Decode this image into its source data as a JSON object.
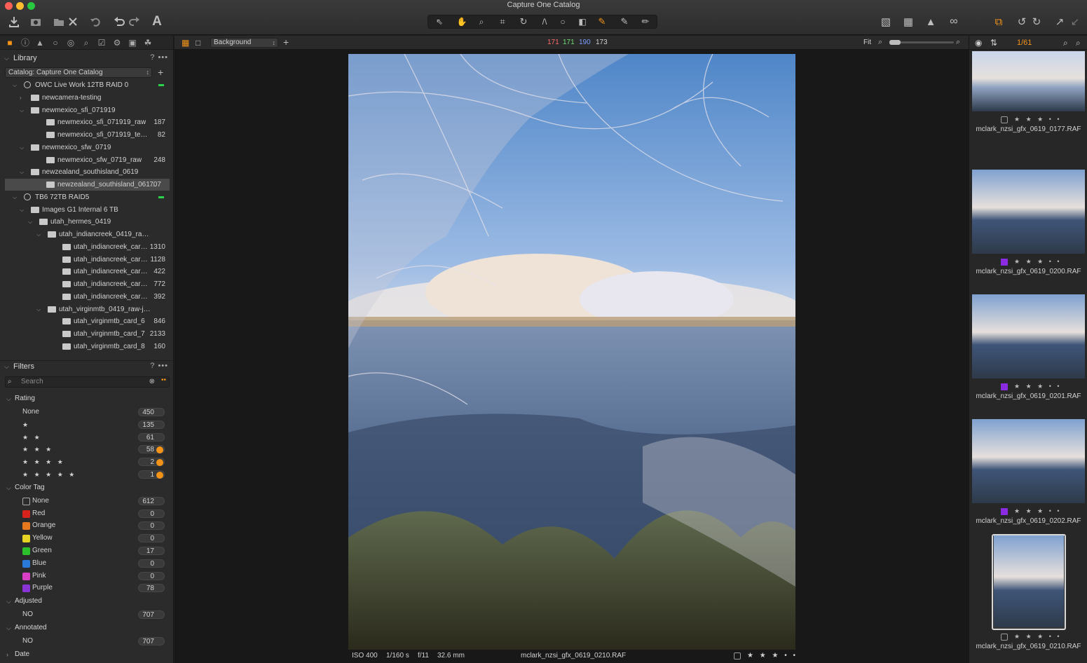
{
  "window": {
    "title": "Capture One Catalog"
  },
  "library": {
    "title": "Library",
    "help": "?",
    "more": "•••",
    "catalog": "Catalog: Capture One Catalog",
    "tree": [
      {
        "name": "OWC Live Work 12TB RAID 0",
        "count": ""
      },
      {
        "name": "newcamera-testing",
        "count": ""
      },
      {
        "name": "newmexico_sfi_071919",
        "count": ""
      },
      {
        "name": "newmexico_sfi_071919_raw",
        "count": "187"
      },
      {
        "name": "newmexico_sfi_071919_testshot...",
        "count": "82"
      },
      {
        "name": "newmexico_sfw_0719",
        "count": ""
      },
      {
        "name": "newmexico_sfw_0719_raw",
        "count": "248"
      },
      {
        "name": "newzealand_southisland_0619",
        "count": ""
      },
      {
        "name": "newzealand_southisland_0619...",
        "count": "707"
      },
      {
        "name": "TB6 72TB RAID5",
        "count": ""
      },
      {
        "name": "Images G1 Internal 6 TB",
        "count": ""
      },
      {
        "name": "utah_hermes_0419",
        "count": ""
      },
      {
        "name": "utah_indiancreek_0419_raw-jpeg",
        "count": ""
      },
      {
        "name": "utah_indiancreek_card_1",
        "count": "1310"
      },
      {
        "name": "utah_indiancreek_card_2",
        "count": "1128"
      },
      {
        "name": "utah_indiancreek_card_3",
        "count": "422"
      },
      {
        "name": "utah_indiancreek_card_4-5",
        "count": "772"
      },
      {
        "name": "utah_indiancreek_card_6",
        "count": "392"
      },
      {
        "name": "utah_virginmtb_0419_raw-jpeg",
        "count": ""
      },
      {
        "name": "utah_virginmtb_card_6",
        "count": "846"
      },
      {
        "name": "utah_virginmtb_card_7",
        "count": "2133"
      },
      {
        "name": "utah_virginmtb_card_8",
        "count": "160"
      }
    ]
  },
  "filters": {
    "title": "Filters",
    "help": "?",
    "more": "•••",
    "search_placeholder": "Search",
    "rating_title": "Rating",
    "rating": [
      {
        "label": "None",
        "count": "450"
      },
      {
        "label": "★",
        "count": "135"
      },
      {
        "label": "★ ★",
        "count": "61"
      },
      {
        "label": "★ ★ ★",
        "count": "58"
      },
      {
        "label": "★ ★ ★ ★",
        "count": "2"
      },
      {
        "label": "★ ★ ★ ★ ★",
        "count": "1"
      }
    ],
    "color_title": "Color Tag",
    "colors": [
      {
        "label": "None",
        "count": "612",
        "color": ""
      },
      {
        "label": "Red",
        "count": "0",
        "color": "#d8231d"
      },
      {
        "label": "Orange",
        "count": "0",
        "color": "#e8781e"
      },
      {
        "label": "Yellow",
        "count": "0",
        "color": "#e6d324"
      },
      {
        "label": "Green",
        "count": "17",
        "color": "#2cc12a"
      },
      {
        "label": "Blue",
        "count": "0",
        "color": "#2a79d8"
      },
      {
        "label": "Pink",
        "count": "0",
        "color": "#d83fc5"
      },
      {
        "label": "Purple",
        "count": "78",
        "color": "#8b34d6"
      }
    ],
    "adjusted_title": "Adjusted",
    "adjusted": {
      "label": "NO",
      "count": "707"
    },
    "annotated_title": "Annotated",
    "annotated": {
      "label": "NO",
      "count": "707"
    },
    "date_title": "Date"
  },
  "viewer": {
    "background": "Background",
    "r": "171",
    "g": "171",
    "b": "190",
    "l": "173",
    "fit": "Fit",
    "iso": "ISO 400",
    "shutter": "1/160 s",
    "aperture": "f/11",
    "focal": "32.6 mm",
    "filename": "mclark_nzsi_gfx_0619_0210.RAF",
    "rating": "★ ★ ★ • •"
  },
  "browser": {
    "counter": "1/61",
    "items": [
      {
        "name": "mclark_nzsi_gfx_0619_0177.RAF",
        "rating": "★ ★ ★ • •",
        "tag": "none"
      },
      {
        "name": "mclark_nzsi_gfx_0619_0200.RAF",
        "rating": "★ ★ ★ • •",
        "tag": "purple"
      },
      {
        "name": "mclark_nzsi_gfx_0619_0201.RAF",
        "rating": "★ ★ ★ • •",
        "tag": "purple"
      },
      {
        "name": "mclark_nzsi_gfx_0619_0202.RAF",
        "rating": "★ ★ ★ • •",
        "tag": "purple"
      },
      {
        "name": "mclark_nzsi_gfx_0619_0210.RAF",
        "rating": "★ ★ ★ • •",
        "tag": "none"
      }
    ]
  },
  "colors": {
    "accent": "#f39419",
    "selected": "#4a4a4a",
    "drive_ok": "#2bd44b"
  }
}
